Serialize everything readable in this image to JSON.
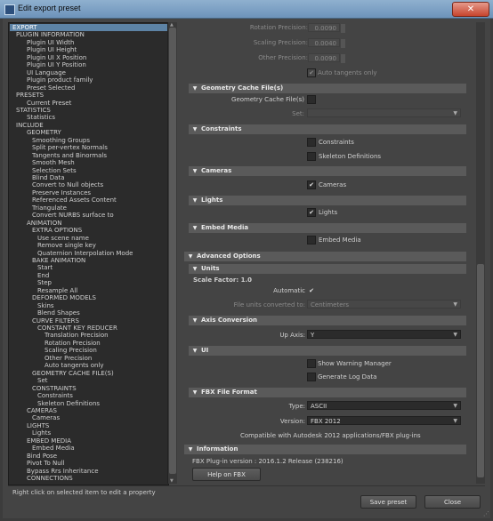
{
  "window": {
    "title": "Edit export preset",
    "close_glyph": "✕"
  },
  "tree": {
    "items": [
      {
        "label": "EXPORT"
      },
      {
        "label": "PLUGIN INFORMATION"
      },
      {
        "label": "Plugin UI Width"
      },
      {
        "label": "Plugin UI Height"
      },
      {
        "label": "Plugin UI X Position"
      },
      {
        "label": "Plugin UI Y Position"
      },
      {
        "label": "UI Language"
      },
      {
        "label": "Plugin product family"
      },
      {
        "label": "Preset Selected"
      },
      {
        "label": "PRESETS"
      },
      {
        "label": "Current Preset"
      },
      {
        "label": "STATISTICS"
      },
      {
        "label": "Statistics"
      },
      {
        "label": "INCLUDE"
      },
      {
        "label": "GEOMETRY"
      },
      {
        "label": "Smoothing Groups"
      },
      {
        "label": "Split per-vertex Normals"
      },
      {
        "label": "Tangents and Binormals"
      },
      {
        "label": "Smooth Mesh"
      },
      {
        "label": "Selection Sets"
      },
      {
        "label": "Blind Data"
      },
      {
        "label": "Convert to Null objects"
      },
      {
        "label": "Preserve Instances"
      },
      {
        "label": "Referenced Assets Content"
      },
      {
        "label": "Triangulate"
      },
      {
        "label": "Convert NURBS surface to"
      },
      {
        "label": "ANIMATION"
      },
      {
        "label": "EXTRA OPTIONS"
      },
      {
        "label": "Use scene name"
      },
      {
        "label": "Remove single key"
      },
      {
        "label": "Quaternion Interpolation Mode"
      },
      {
        "label": "BAKE ANIMATION"
      },
      {
        "label": "Start"
      },
      {
        "label": "End"
      },
      {
        "label": "Step"
      },
      {
        "label": "Resample All"
      },
      {
        "label": "DEFORMED MODELS"
      },
      {
        "label": "Skins"
      },
      {
        "label": "Blend Shapes"
      },
      {
        "label": "CURVE FILTERS"
      },
      {
        "label": "CONSTANT KEY REDUCER"
      },
      {
        "label": "Translation Precision"
      },
      {
        "label": "Rotation Precision"
      },
      {
        "label": "Scaling Precision"
      },
      {
        "label": "Other Precision"
      },
      {
        "label": "Auto tangents only"
      },
      {
        "label": "GEOMETRY CACHE FILE(S)"
      },
      {
        "label": "Set"
      },
      {
        "label": "CONSTRAINTS"
      },
      {
        "label": "Constraints"
      },
      {
        "label": "Skeleton Definitions"
      },
      {
        "label": "CAMERAS"
      },
      {
        "label": "Cameras"
      },
      {
        "label": "LIGHTS"
      },
      {
        "label": "Lights"
      },
      {
        "label": "EMBED MEDIA"
      },
      {
        "label": "Embed Media"
      },
      {
        "label": "Bind Pose"
      },
      {
        "label": "Pivot To Null"
      },
      {
        "label": "Bypass Rrs Inheritance"
      },
      {
        "label": "CONNECTIONS"
      }
    ]
  },
  "panel": {
    "rotation_precision": {
      "label": "Rotation Precision:",
      "value": "0.0090"
    },
    "scaling_precision": {
      "label": "Scaling Precision:",
      "value": "0.0040"
    },
    "other_precision": {
      "label": "Other Precision:",
      "value": "0.0090"
    },
    "auto_tangents": {
      "label": "Auto tangents only",
      "check": "✔"
    },
    "geometry_cache": {
      "title": "Geometry Cache File(s)",
      "field_label": "Geometry Cache File(s)",
      "set_label": "Set:",
      "set_value": ""
    },
    "constraints": {
      "title": "Constraints",
      "constraints_label": "Constraints",
      "skeleton_label": "Skeleton Definitions"
    },
    "cameras": {
      "title": "Cameras",
      "label": "Cameras",
      "check": "✔"
    },
    "lights": {
      "title": "Lights",
      "label": "Lights",
      "check": "✔"
    },
    "embed_media": {
      "title": "Embed Media",
      "label": "Embed Media"
    },
    "advanced": {
      "title": "Advanced Options"
    },
    "units": {
      "title": "Units",
      "scale_factor": "Scale Factor: 1.0",
      "automatic_label": "Automatic",
      "automatic_check": "✔",
      "converted_label": "File units converted to:",
      "converted_value": "Centimeters"
    },
    "axis": {
      "title": "Axis Conversion",
      "up_label": "Up Axis:",
      "up_value": "Y"
    },
    "ui": {
      "title": "UI",
      "warning_label": "Show Warning Manager",
      "log_label": "Generate Log Data"
    },
    "fbx_format": {
      "title": "FBX File Format",
      "type_label": "Type:",
      "type_value": "ASCII",
      "version_label": "Version:",
      "version_value": "FBX 2012",
      "compat": "Compatible with Autodesk 2012 applications/FBX plug-ins"
    },
    "information": {
      "title": "Information",
      "version_text": "FBX Plug-in version :  2016.1.2 Release (238216)",
      "help_button": "Help on FBX"
    }
  },
  "footer": {
    "status": "Right click on selected item to edit a property",
    "save_button": "Save preset",
    "close_button": "Close"
  },
  "colors": {
    "selection": "#5d83a5",
    "section_header": "#5a5a5a",
    "background": "#444444"
  }
}
